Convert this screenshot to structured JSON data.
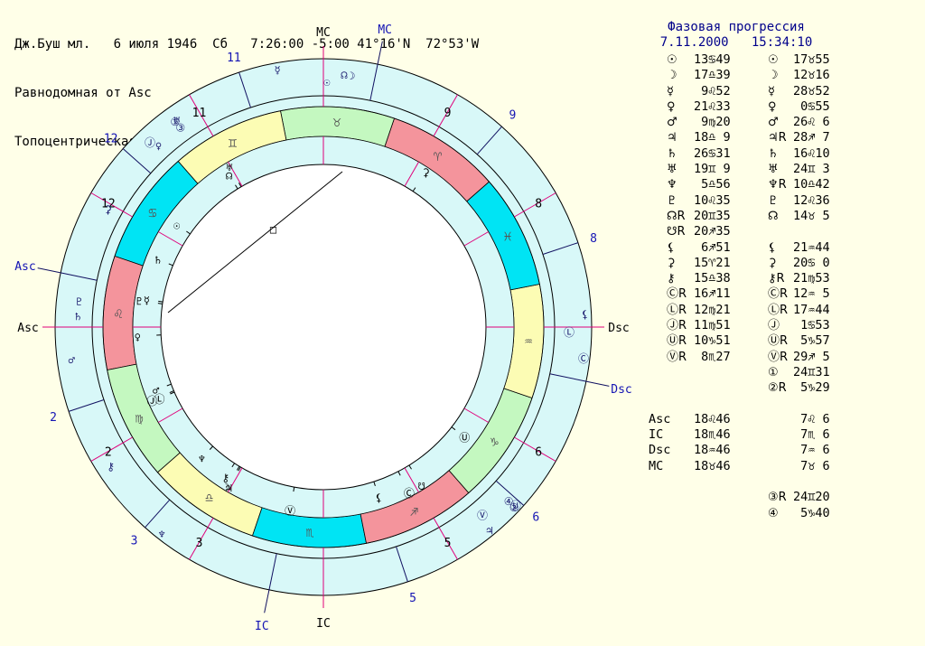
{
  "header": {
    "line1": "Дж.Буш мл.   6 июля 1946  Сб   7:26:00 -5:00 41°16'N  72°53'W",
    "line2": "Равнодомная от Asc",
    "line3": "Топоцентрическая"
  },
  "panel": {
    "title": "Фазовая прогрессия",
    "subtitle": "7.11.2000   15:34:10",
    "rows": [
      {
        "g1": "☉",
        "v1": "13♋49",
        "g2": "☉",
        "v2": "17♉55"
      },
      {
        "g1": "☽",
        "v1": "17♎39",
        "g2": "☽",
        "v2": "12♉16"
      },
      {
        "g1": "☿",
        "v1": " 9♌52",
        "g2": "☿",
        "v2": "28♉52"
      },
      {
        "g1": "♀",
        "v1": "21♌33",
        "g2": "♀",
        "v2": " 0♋55"
      },
      {
        "g1": "♂",
        "v1": " 9♍20",
        "g2": "♂",
        "v2": "26♌ 6"
      },
      {
        "g1": "♃",
        "v1": "18♎ 9",
        "g2": "♃R",
        "v2": "28♐ 7"
      },
      {
        "g1": "♄",
        "v1": "26♋31",
        "g2": "♄",
        "v2": "16♌10"
      },
      {
        "g1": "♅",
        "v1": "19♊ 9",
        "g2": "♅",
        "v2": "24♊ 3"
      },
      {
        "g1": "♆",
        "v1": " 5♎56",
        "g2": "♆R",
        "v2": "10♎42"
      },
      {
        "g1": "♇",
        "v1": "10♌35",
        "g2": "♇",
        "v2": "12♌36"
      },
      {
        "g1": "☊R",
        "v1": "20♊35",
        "g2": "☊",
        "v2": "14♉ 5"
      },
      {
        "g1": "☋R",
        "v1": "20♐35",
        "g2": "",
        "v2": ""
      },
      {
        "g1": "⚸",
        "v1": " 6♐51",
        "g2": "⚸",
        "v2": "21♒44"
      },
      {
        "g1": "⚳",
        "v1": "15♈21",
        "g2": "⚳",
        "v2": "20♋ 0"
      },
      {
        "g1": "⚷",
        "v1": "15♎38",
        "g2": "⚷R",
        "v2": "21♍53"
      },
      {
        "g1": "ⒸR",
        "v1": "16♐11",
        "g2": "ⒸR",
        "v2": "12♒ 5"
      },
      {
        "g1": "ⓁR",
        "v1": "12♍21",
        "g2": "ⓁR",
        "v2": "17♒44"
      },
      {
        "g1": "ⒿR",
        "v1": "11♍51",
        "g2": "Ⓙ",
        "v2": " 1♋53"
      },
      {
        "g1": "ⓊR",
        "v1": "10♑51",
        "g2": "ⓊR",
        "v2": " 5♑57"
      },
      {
        "g1": "ⓋR",
        "v1": " 8♏27",
        "g2": "ⓋR",
        "v2": "29♐ 5"
      },
      {
        "g1": "",
        "v1": "",
        "g2": "①",
        "v2": "24♊31"
      },
      {
        "g1": "",
        "v1": "",
        "g2": "②R",
        "v2": " 5♑29"
      },
      {
        "g1": "",
        "v1": "",
        "g2": "",
        "v2": ""
      },
      {
        "g1": "Asc",
        "v1": "18♌46",
        "g2": "",
        "v2": " 7♌ 6"
      },
      {
        "g1": "IC",
        "v1": "18♏46",
        "g2": "",
        "v2": " 7♏ 6"
      },
      {
        "g1": "Dsc",
        "v1": "18♒46",
        "g2": "",
        "v2": " 7♒ 6"
      },
      {
        "g1": "MC",
        "v1": "18♉46",
        "g2": "",
        "v2": " 7♉ 6"
      },
      {
        "g1": "",
        "v1": "",
        "g2": "",
        "v2": ""
      },
      {
        "g1": "",
        "v1": "",
        "g2": "③R",
        "v2": "24♊20"
      },
      {
        "g1": "",
        "v1": "",
        "g2": "④",
        "v2": " 5♑40"
      }
    ]
  },
  "chart": {
    "colors": {
      "outer_ring": "#d8f8f8",
      "inner_ring": "#d8f8f8",
      "fire": "#f4949c",
      "earth": "#c4f8c0",
      "air": "#fcfcb4",
      "water": "#00e4f4",
      "line": "#000000",
      "cusp": "#e0007a",
      "accent": "#1414b4"
    },
    "asc_degree": 138.77,
    "zodiac": [
      {
        "sign": "♈",
        "element": "fire"
      },
      {
        "sign": "♉",
        "element": "earth"
      },
      {
        "sign": "♊",
        "element": "air"
      },
      {
        "sign": "♋",
        "element": "water"
      },
      {
        "sign": "♌",
        "element": "fire"
      },
      {
        "sign": "♍",
        "element": "earth"
      },
      {
        "sign": "♎",
        "element": "air"
      },
      {
        "sign": "♏",
        "element": "water"
      },
      {
        "sign": "♐",
        "element": "fire"
      },
      {
        "sign": "♑",
        "element": "earth"
      },
      {
        "sign": "♒",
        "element": "air"
      },
      {
        "sign": "♓",
        "element": "water"
      }
    ],
    "axis_labels": [
      {
        "text": "Asc",
        "lon": 138.77,
        "color": "#000000"
      },
      {
        "text": "Dsc",
        "lon": 318.77,
        "color": "#000000"
      },
      {
        "text": "MC",
        "lon": 48.77,
        "color": "#000000"
      },
      {
        "text": "IC",
        "lon": 228.77,
        "color": "#000000"
      },
      {
        "text": "Asc",
        "lon": 127.1,
        "color": "#1414b4"
      },
      {
        "text": "Dsc",
        "lon": 307.1,
        "color": "#1414b4"
      },
      {
        "text": "MC",
        "lon": 37.1,
        "color": "#1414b4"
      },
      {
        "text": "IC",
        "lon": 217.1,
        "color": "#1414b4"
      }
    ],
    "house_labels": [
      {
        "text": "2",
        "lon": 168.77,
        "color": "#000000"
      },
      {
        "text": "3",
        "lon": 198.77,
        "color": "#000000"
      },
      {
        "text": "5",
        "lon": 258.77,
        "color": "#000000"
      },
      {
        "text": "6",
        "lon": 288.77,
        "color": "#000000"
      },
      {
        "text": "8",
        "lon": 348.77,
        "color": "#000000"
      },
      {
        "text": "9",
        "lon": 18.77,
        "color": "#000000"
      },
      {
        "text": "11",
        "lon": 78.77,
        "color": "#000000"
      },
      {
        "text": "12",
        "lon": 108.77,
        "color": "#000000"
      },
      {
        "text": "2",
        "lon": 157.1,
        "color": "#1414b4"
      },
      {
        "text": "3",
        "lon": 187.1,
        "color": "#1414b4"
      },
      {
        "text": "5",
        "lon": 247.1,
        "color": "#1414b4"
      },
      {
        "text": "6",
        "lon": 277.1,
        "color": "#1414b4"
      },
      {
        "text": "8",
        "lon": 337.1,
        "color": "#1414b4"
      },
      {
        "text": "9",
        "lon": 7.1,
        "color": "#1414b4"
      },
      {
        "text": "11",
        "lon": 67.1,
        "color": "#1414b4"
      },
      {
        "text": "12",
        "lon": 97.1,
        "color": "#1414b4"
      }
    ],
    "natal_planets": [
      {
        "glyph": "☉",
        "lon": 103.82
      },
      {
        "glyph": "☽",
        "lon": 197.65
      },
      {
        "glyph": "☿",
        "lon": 129.87
      },
      {
        "glyph": "♀",
        "lon": 141.55
      },
      {
        "glyph": "♂",
        "lon": 159.33
      },
      {
        "glyph": "♃",
        "lon": 198.15
      },
      {
        "glyph": "♄",
        "lon": 116.52
      },
      {
        "glyph": "♅",
        "lon": 79.15
      },
      {
        "glyph": "♆",
        "lon": 185.93
      },
      {
        "glyph": "♇",
        "lon": 130.58
      },
      {
        "glyph": "☊",
        "lon": 80.58
      },
      {
        "glyph": "☋",
        "lon": 260.58
      },
      {
        "glyph": "⚸",
        "lon": 246.85
      },
      {
        "glyph": "⚳",
        "lon": 15.35
      },
      {
        "glyph": "⚷",
        "lon": 195.63
      },
      {
        "glyph": "Ⓒ",
        "lon": 256.18
      },
      {
        "glyph": "Ⓛ",
        "lon": 162.35
      },
      {
        "glyph": "Ⓙ",
        "lon": 161.85
      },
      {
        "glyph": "Ⓤ",
        "lon": 280.85
      },
      {
        "glyph": "Ⓥ",
        "lon": 218.45
      }
    ],
    "prog_planets": [
      {
        "glyph": "☉",
        "lon": 47.92
      },
      {
        "glyph": "☽",
        "lon": 42.27
      },
      {
        "glyph": "☿",
        "lon": 58.87
      },
      {
        "glyph": "♀",
        "lon": 90.92
      },
      {
        "glyph": "♂",
        "lon": 146.1
      },
      {
        "glyph": "♃",
        "lon": 268.12
      },
      {
        "glyph": "♄",
        "lon": 136.17
      },
      {
        "glyph": "♅",
        "lon": 84.05
      },
      {
        "glyph": "♆",
        "lon": 190.7
      },
      {
        "glyph": "♇",
        "lon": 132.6
      },
      {
        "glyph": "☊",
        "lon": 44.08
      },
      {
        "glyph": "⚸",
        "lon": 321.73
      },
      {
        "glyph": "⚳",
        "lon": 110.0
      },
      {
        "glyph": "⚷",
        "lon": 171.88
      },
      {
        "glyph": "Ⓒ",
        "lon": 312.08
      },
      {
        "glyph": "Ⓛ",
        "lon": 317.73
      },
      {
        "glyph": "Ⓙ",
        "lon": 91.88
      },
      {
        "glyph": "Ⓤ",
        "lon": 275.95
      },
      {
        "glyph": "Ⓥ",
        "lon": 269.08
      },
      {
        "glyph": "①",
        "lon": 84.52
      },
      {
        "glyph": "②",
        "lon": 275.48
      },
      {
        "glyph": "③",
        "lon": 84.33
      },
      {
        "glyph": "④",
        "lon": 275.67
      }
    ],
    "aspect_point": "□"
  }
}
